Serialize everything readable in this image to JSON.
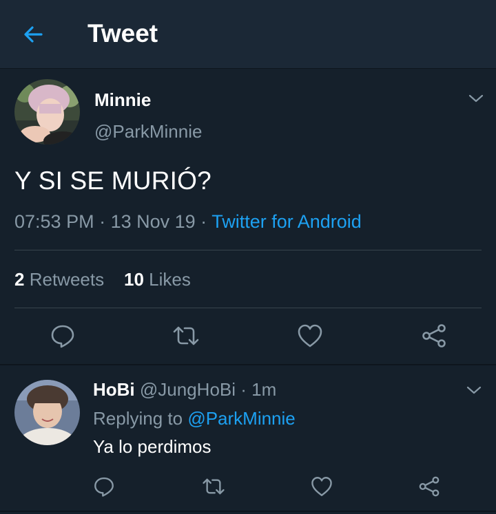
{
  "header": {
    "title": "Tweet",
    "back_icon": "arrow-left-icon"
  },
  "tweet": {
    "author_name": "Minnie",
    "author_handle": "@ParkMinnie",
    "text": "Y SI SE MURIÓ?",
    "time": "07:53 PM",
    "separator1": " · ",
    "date": "13 Nov 19",
    "separator2": " · ",
    "source": "Twitter for Android",
    "retweet_count": "2",
    "retweet_label": "Retweets",
    "like_count": "10",
    "like_label": "Likes"
  },
  "reply": {
    "author_name": "HoBi",
    "author_handle": "@JungHoBi",
    "separator": " · ",
    "time": "1m",
    "replying_label": "Replying to ",
    "replying_to": "@ParkMinnie",
    "text": "Ya lo perdimos"
  },
  "colors": {
    "background": "#15202b",
    "header": "#1b2836",
    "accent": "#1da1f2",
    "secondary_text": "#8899a6"
  }
}
